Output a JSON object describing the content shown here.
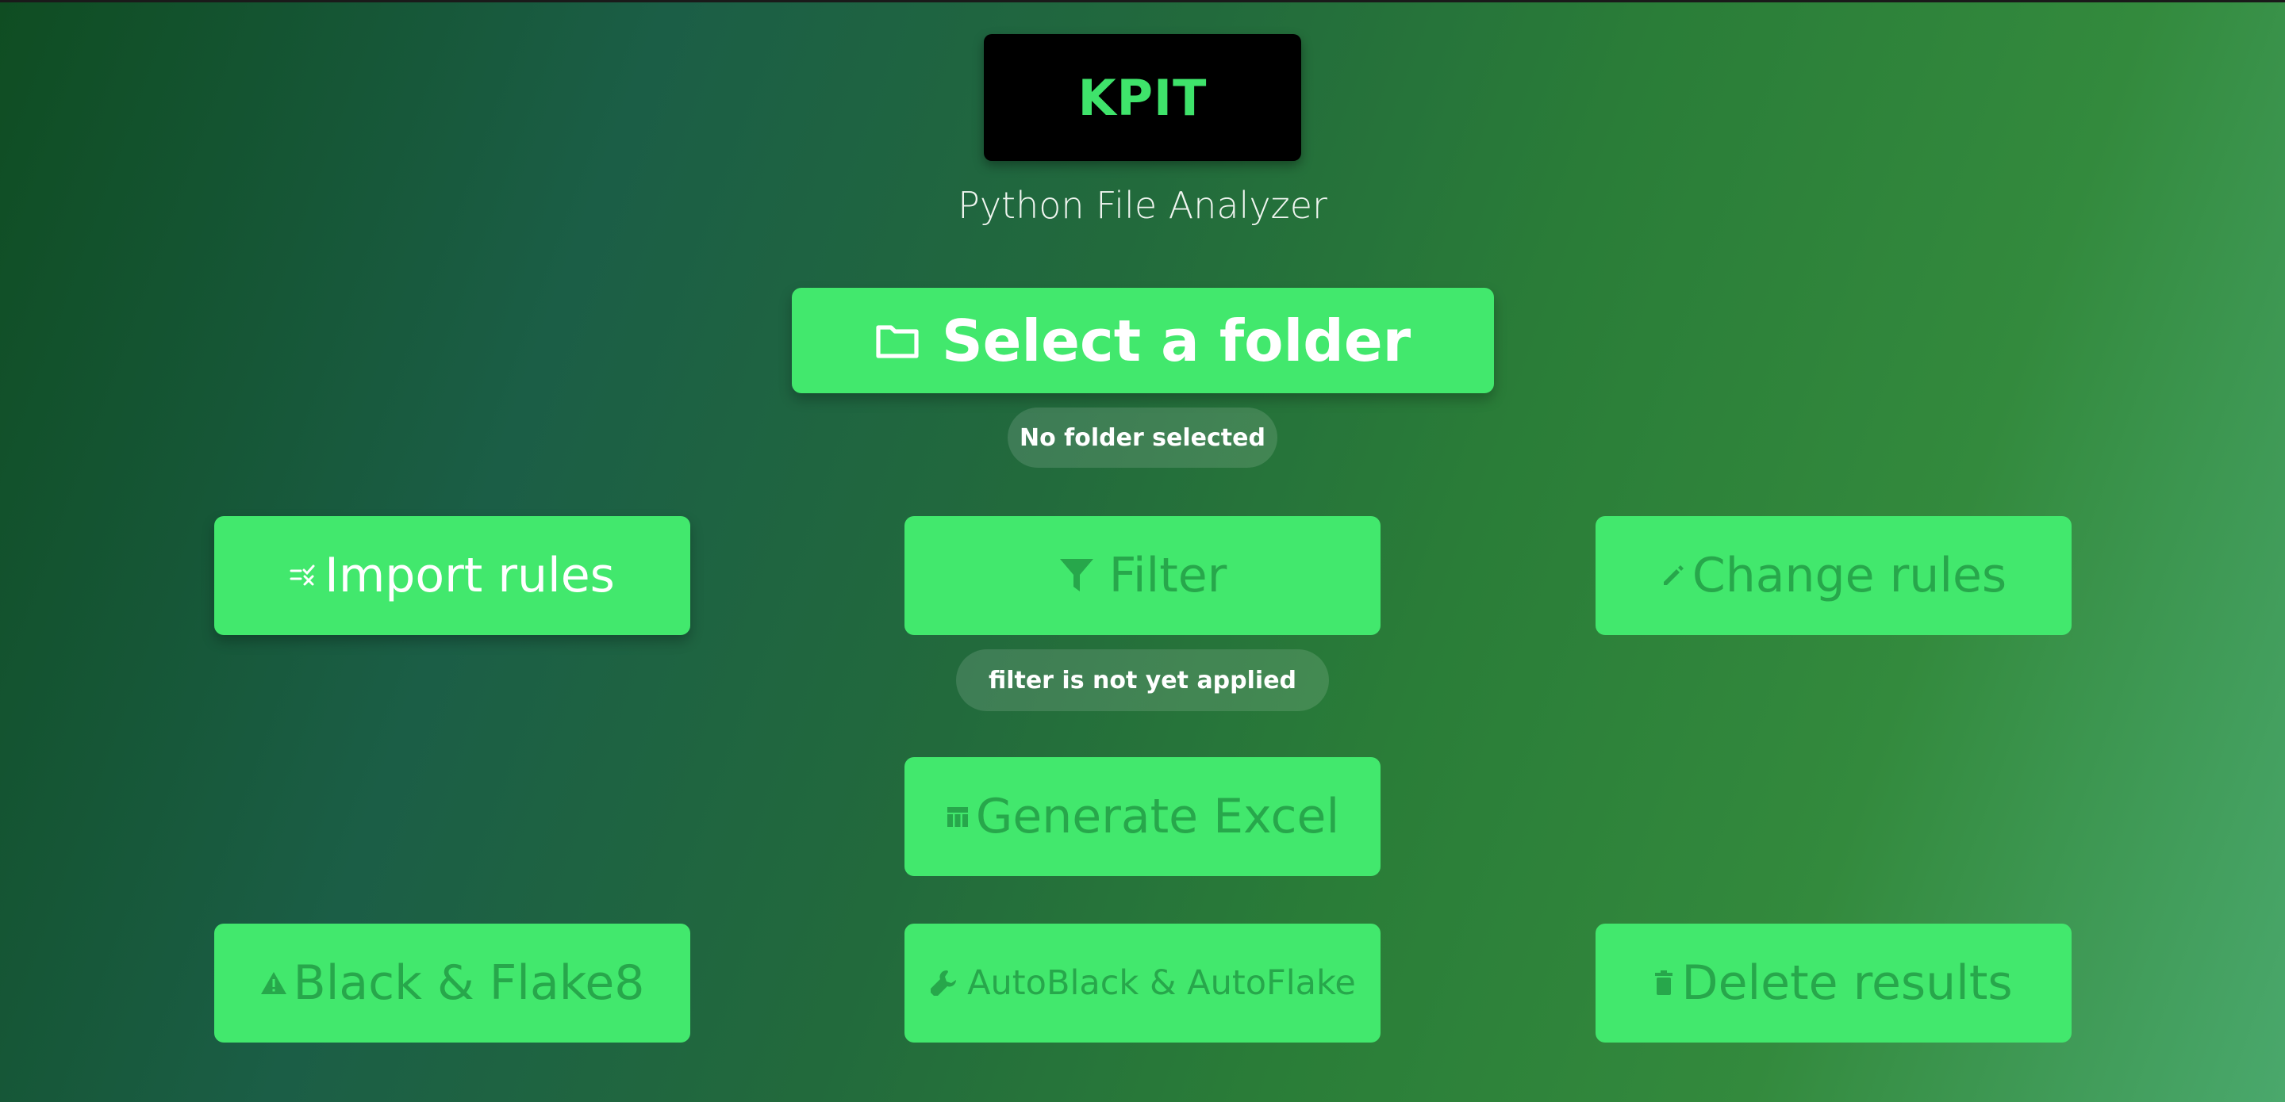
{
  "header": {
    "logo": "KPIT",
    "subtitle": "Python File Analyzer"
  },
  "folder": {
    "select_label": "Select a folder",
    "status": "No folder selected"
  },
  "actions": {
    "import_rules": "Import rules",
    "filter": "Filter",
    "change_rules": "Change rules",
    "filter_status": "filter is not yet applied",
    "generate_excel": "Generate Excel",
    "black_flake8": "Black & Flake8",
    "autoblack_autoflake": "AutoBlack & AutoFlake",
    "delete_results": "Delete results"
  },
  "icons": {
    "select_folder": "folder-icon",
    "import_rules": "rule-list-icon",
    "filter": "funnel-icon",
    "change_rules": "pencil-icon",
    "generate_excel": "table-icon",
    "black_flake8": "warning-icon",
    "autoblack_autoflake": "wrench-icon",
    "delete_results": "trash-icon"
  },
  "colors": {
    "button": "#42e86d",
    "button_text_enabled": "#ffffff",
    "button_text_disabled": "#27a74b",
    "logo_text": "#3fe36b",
    "logo_background": "#000000"
  }
}
